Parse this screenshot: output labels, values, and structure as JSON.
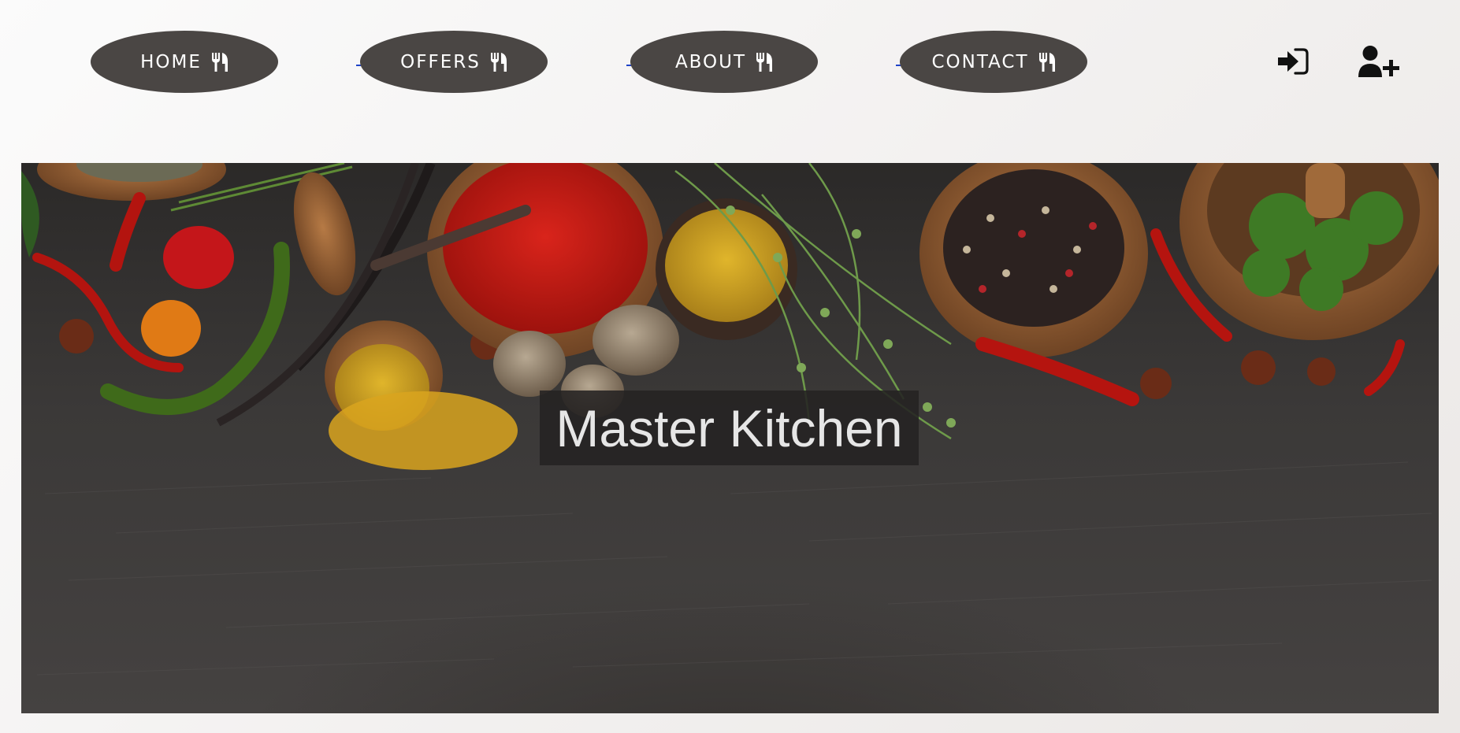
{
  "nav": {
    "items": [
      {
        "label": "HOME",
        "icon": "utensils-icon"
      },
      {
        "label": "OFFERS",
        "icon": "utensils-icon"
      },
      {
        "label": "ABOUT",
        "icon": "utensils-icon"
      },
      {
        "label": "CONTACT",
        "icon": "utensils-icon"
      }
    ],
    "login_icon": "sign-in-icon",
    "register_icon": "user-plus-icon"
  },
  "hero": {
    "title": "Master Kitchen",
    "image": "spices-on-slate"
  },
  "colors": {
    "pill_bg": "#4a4644",
    "pill_text": "#ffffff",
    "link_underline": "#1f43c8",
    "title_box": "#242222",
    "title_text": "#e6e6e6"
  }
}
